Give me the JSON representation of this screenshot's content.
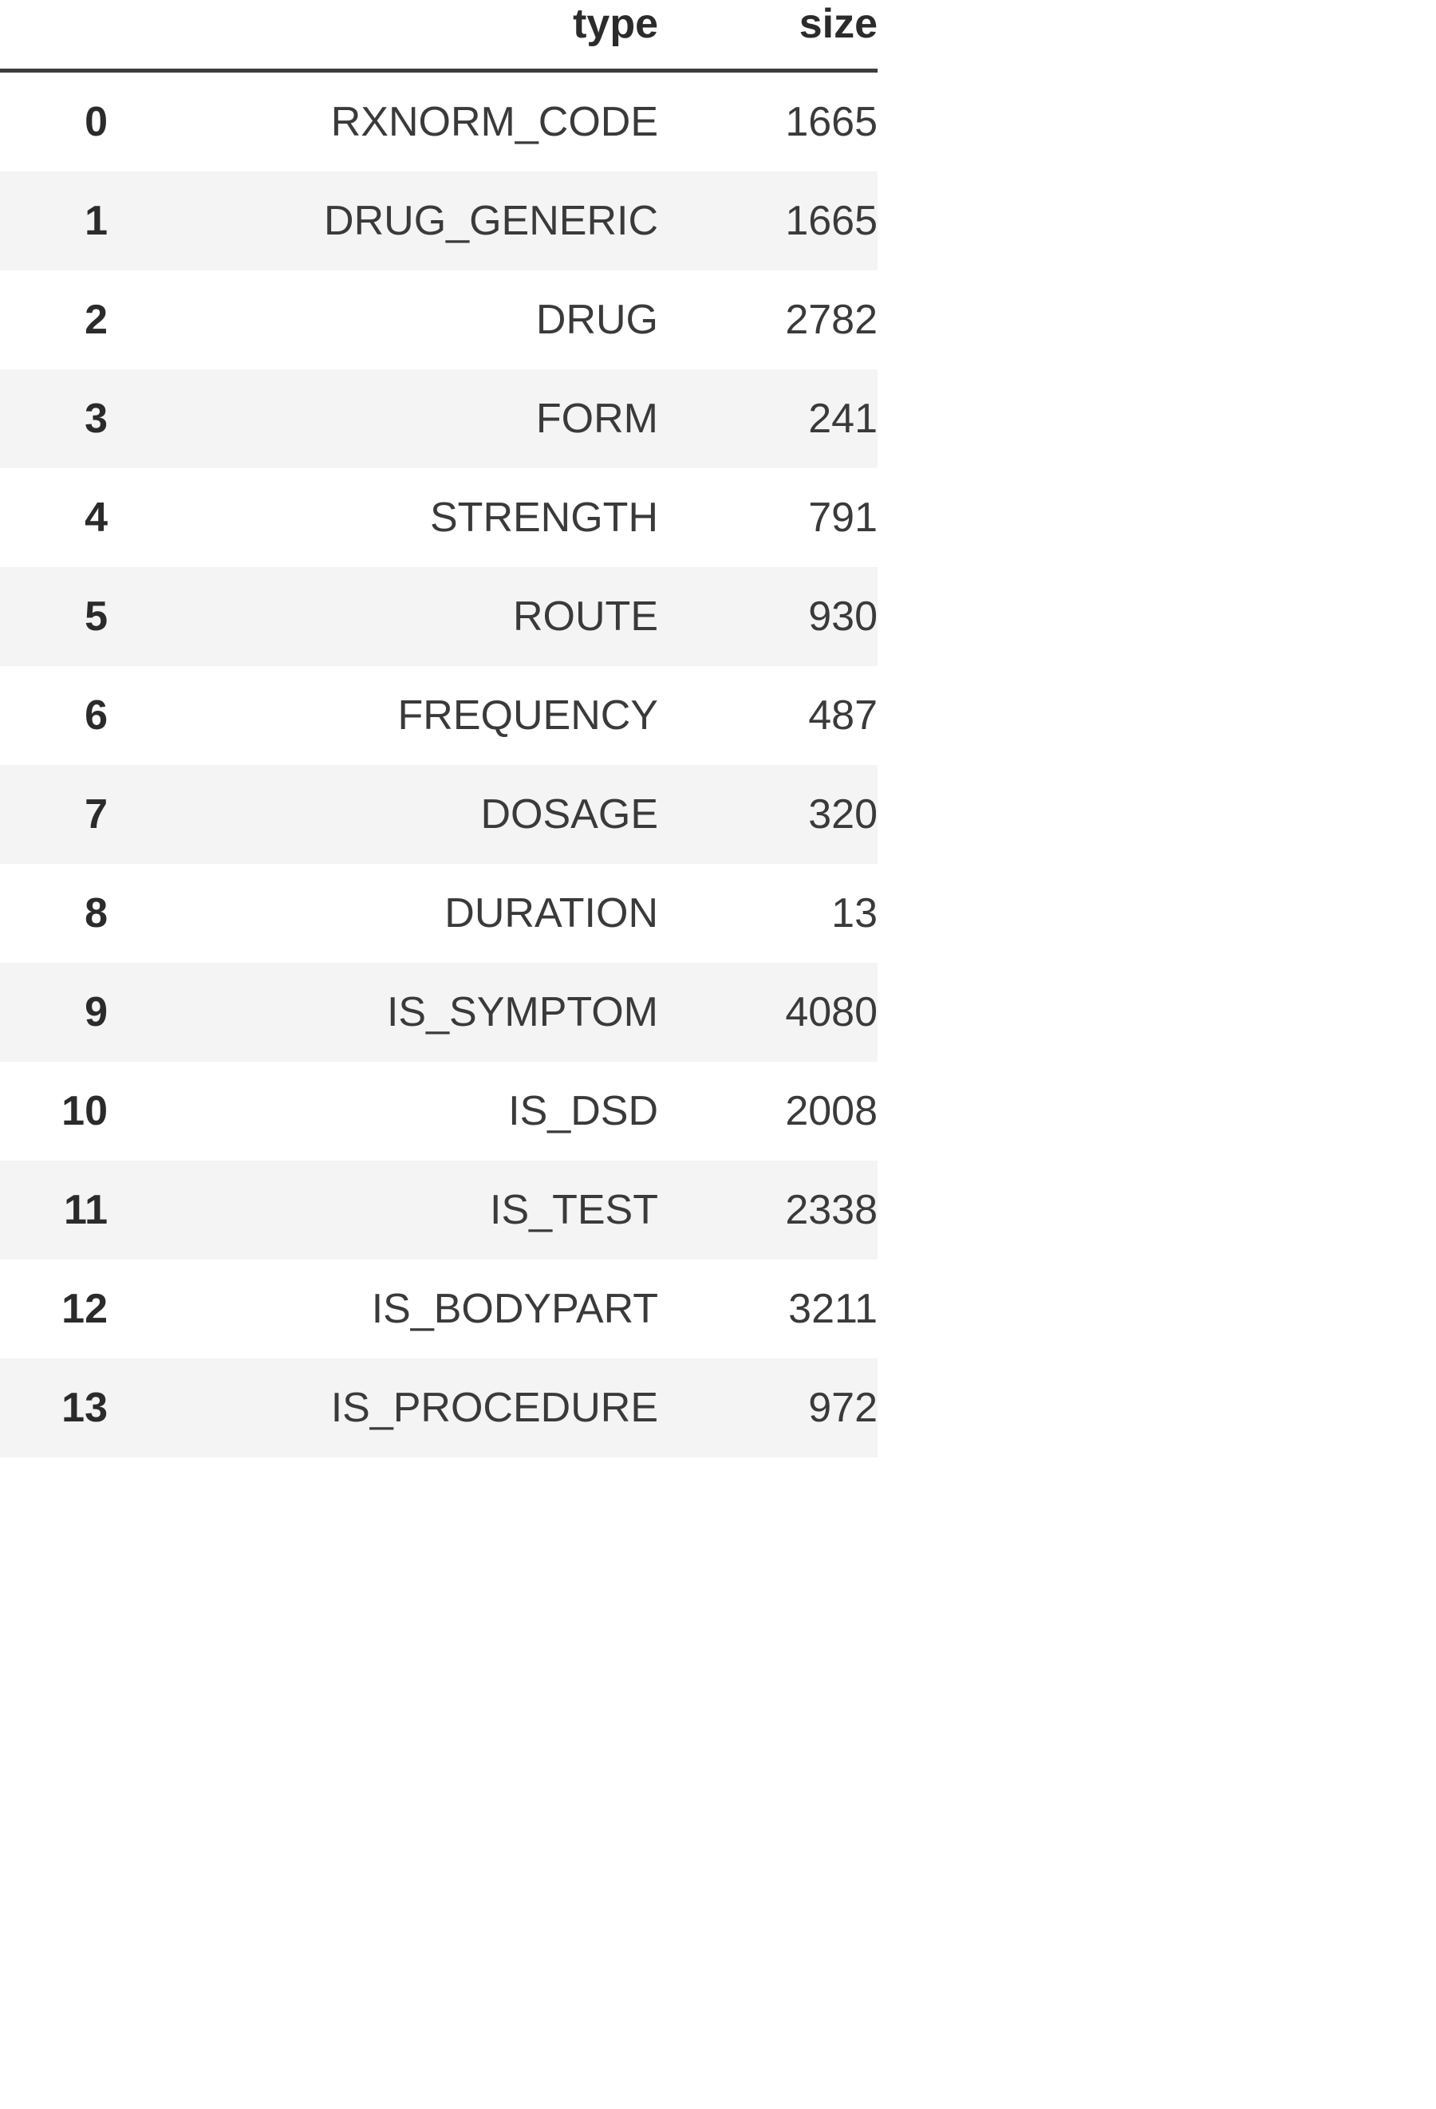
{
  "table": {
    "index_header": "",
    "columns": [
      "type",
      "size"
    ],
    "rows": [
      {
        "index": "0",
        "type": "RXNORM_CODE",
        "size": "1665"
      },
      {
        "index": "1",
        "type": "DRUG_GENERIC",
        "size": "1665"
      },
      {
        "index": "2",
        "type": "DRUG",
        "size": "2782"
      },
      {
        "index": "3",
        "type": "FORM",
        "size": "241"
      },
      {
        "index": "4",
        "type": "STRENGTH",
        "size": "791"
      },
      {
        "index": "5",
        "type": "ROUTE",
        "size": "930"
      },
      {
        "index": "6",
        "type": "FREQUENCY",
        "size": "487"
      },
      {
        "index": "7",
        "type": "DOSAGE",
        "size": "320"
      },
      {
        "index": "8",
        "type": "DURATION",
        "size": "13"
      },
      {
        "index": "9",
        "type": "IS_SYMPTOM",
        "size": "4080"
      },
      {
        "index": "10",
        "type": "IS_DSD",
        "size": "2008"
      },
      {
        "index": "11",
        "type": "IS_TEST",
        "size": "2338"
      },
      {
        "index": "12",
        "type": "IS_BODYPART",
        "size": "3211"
      },
      {
        "index": "13",
        "type": "IS_PROCEDURE",
        "size": "972"
      }
    ]
  },
  "chart_data": {
    "type": "table",
    "title": "",
    "categories": [
      "RXNORM_CODE",
      "DRUG_GENERIC",
      "DRUG",
      "FORM",
      "STRENGTH",
      "ROUTE",
      "FREQUENCY",
      "DOSAGE",
      "DURATION",
      "IS_SYMPTOM",
      "IS_DSD",
      "IS_TEST",
      "IS_BODYPART",
      "IS_PROCEDURE"
    ],
    "values": [
      1665,
      1665,
      2782,
      241,
      791,
      930,
      487,
      320,
      13,
      4080,
      2008,
      2338,
      3211,
      972
    ],
    "xlabel": "type",
    "ylabel": "size"
  },
  "style": {
    "stripe_color": "#f4f4f4",
    "text_color": "#2b2b2b",
    "rule_color": "#3d3d3d",
    "background": "#ffffff"
  }
}
